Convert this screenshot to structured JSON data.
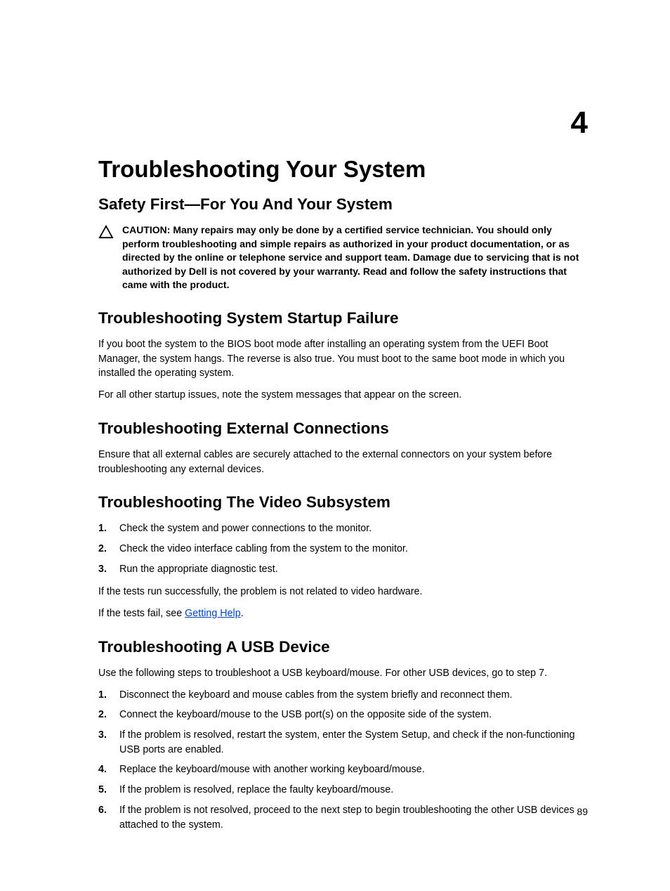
{
  "chapter_number": "4",
  "title": "Troubleshooting Your System",
  "sections": {
    "safety": {
      "heading": "Safety First—For You And Your System",
      "caution": "CAUTION: Many repairs may only be done by a certified service technician. You should only perform troubleshooting and simple repairs as authorized in your product documentation, or as directed by the online or telephone service and support team. Damage due to servicing that is not authorized by Dell is not covered by your warranty. Read and follow the safety instructions that came with the product."
    },
    "startup": {
      "heading": "Troubleshooting System Startup Failure",
      "p1": "If you boot the system to the BIOS boot mode after installing an operating system from the UEFI Boot Manager, the system hangs. The reverse is also true. You must boot to the same boot mode in which you installed the operating system.",
      "p2": "For all other startup issues, note the system messages that appear on the screen."
    },
    "external": {
      "heading": "Troubleshooting External Connections",
      "p1": "Ensure that all external cables are securely attached to the external connectors on your system before troubleshooting any external devices."
    },
    "video": {
      "heading": "Troubleshooting The Video Subsystem",
      "steps": [
        "Check the system and power connections to the monitor.",
        "Check the video interface cabling from the system to the monitor.",
        "Run the appropriate diagnostic test."
      ],
      "p1": "If the tests run successfully, the problem is not related to video hardware.",
      "p2_prefix": "If the tests fail, see ",
      "p2_link": "Getting Help",
      "p2_suffix": "."
    },
    "usb": {
      "heading": "Troubleshooting A USB Device",
      "p1": "Use the following steps to troubleshoot a USB keyboard/mouse. For other USB devices, go to step 7.",
      "steps": [
        "Disconnect the keyboard and mouse cables from the system briefly and reconnect them.",
        "Connect the keyboard/mouse to the USB port(s) on the opposite side of the system.",
        "If the problem is resolved, restart the system, enter the System Setup, and check if the non-functioning USB ports are enabled.",
        "Replace the keyboard/mouse with another working keyboard/mouse.",
        "If the problem is resolved, replace the faulty keyboard/mouse.",
        "If the problem is not resolved, proceed to the next step to begin troubleshooting the other USB devices attached to the system."
      ]
    }
  },
  "page_number": "89"
}
